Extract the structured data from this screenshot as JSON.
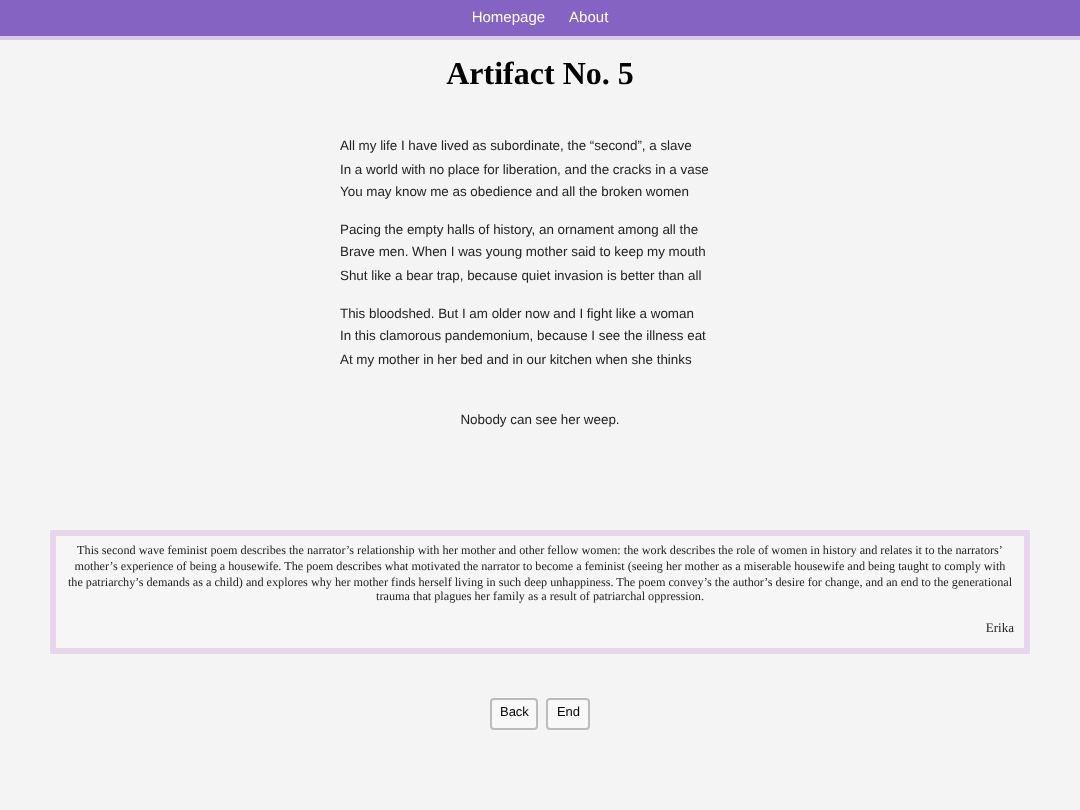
{
  "nav": {
    "links": [
      "Homepage",
      "About"
    ]
  },
  "title": "Artifact No. 5",
  "poem": {
    "stanzas": [
      "All my life I have lived as subordinate, the “second”, a slave\nIn a world with no place for liberation, and the cracks in a vase\nYou may know me as obedience and all the broken women",
      "Pacing the empty halls of history, an ornament among all the\nBrave men. When I was young mother said to keep my mouth\nShut like a bear trap, because quiet invasion is better than all",
      "This bloodshed. But I am older now and I fight like a woman\nIn this clamorous pandemonium, because I see the illness eat\nAt my mother in her bed and in our kitchen when she thinks"
    ],
    "closing": "Nobody can see her weep."
  },
  "description": {
    "text": "This second wave feminist poem describes the narrator’s relationship with her mother and other fellow women: the work describes the role of women in history and relates it to the narrators’ mother’s experience of being a housewife. The poem describes what motivated the narrator to become a feminist (seeing her mother as a miserable housewife and being taught to comply with the patriarchy’s demands as a child) and explores why her mother finds herself living in such deep unhappiness. The poem convey’s the author’s desire for change, and an end to the generational trauma that plagues her family as a result of patriarchal oppression.",
    "author": "Erika"
  },
  "buttons": [
    "Back",
    "End"
  ]
}
